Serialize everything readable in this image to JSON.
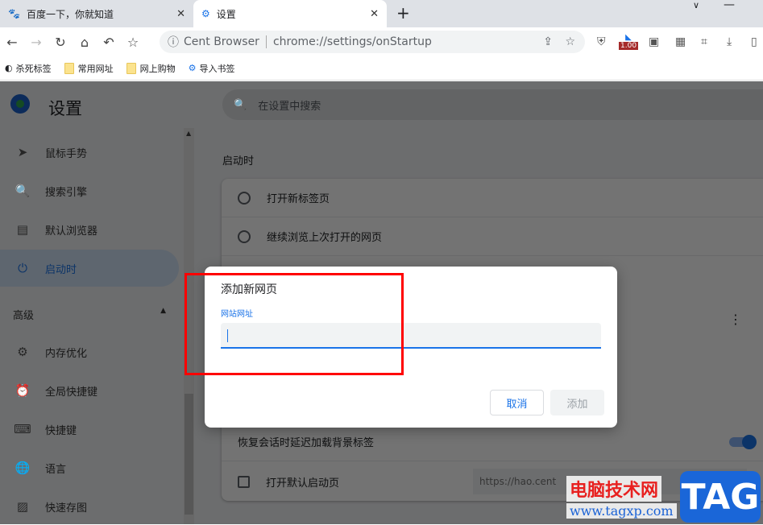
{
  "tabs": [
    {
      "title": "百度一下，你就知道",
      "icon": "baidu-icon"
    },
    {
      "title": "设置",
      "icon": "gear-icon",
      "active": true
    }
  ],
  "omnibox": {
    "site": "Cent Browser",
    "url": "chrome://settings/onStartup"
  },
  "extension_badge": "1.00",
  "bookmarks": [
    {
      "label": "杀死标签",
      "icon": "globe-icon"
    },
    {
      "label": "常用网址",
      "icon": "folder-icon"
    },
    {
      "label": "网上购物",
      "icon": "folder-icon"
    },
    {
      "label": "导入书签",
      "icon": "gear-icon"
    }
  ],
  "settings": {
    "title": "设置",
    "search_placeholder": "在设置中搜索",
    "nav": [
      {
        "label": "鼠标手势",
        "icon": "cursor-icon"
      },
      {
        "label": "搜索引擎",
        "icon": "search-icon"
      },
      {
        "label": "默认浏览器",
        "icon": "browser-icon"
      },
      {
        "label": "启动时",
        "icon": "power-icon",
        "selected": true
      }
    ],
    "advanced_label": "高级",
    "advanced_nav": [
      {
        "label": "内存优化",
        "icon": "chip-icon"
      },
      {
        "label": "全局快捷键",
        "icon": "alarm-icon"
      },
      {
        "label": "快捷键",
        "icon": "keyboard-icon"
      },
      {
        "label": "语言",
        "icon": "globe-icon"
      },
      {
        "label": "快速存图",
        "icon": "image-icon"
      }
    ],
    "section_title": "启动时",
    "options": [
      "打开新标签页",
      "继续浏览上次打开的网页"
    ],
    "lazy_load_label": "恢复会话时延迟加载背景标签",
    "lazy_load_enabled": true,
    "default_start_label": "打开默认启动页",
    "default_start_checked": false,
    "default_start_url": "https://hao.cent"
  },
  "dialog": {
    "title": "添加新网页",
    "field_label": "网站网址",
    "field_value": "",
    "cancel": "取消",
    "add": "添加"
  },
  "watermark": {
    "cn": "电脑技术网",
    "url": "www.tagxp.com",
    "tag": "TAG"
  },
  "colors": {
    "accent": "#1a73e8",
    "highlight_box": "#ff0000"
  }
}
